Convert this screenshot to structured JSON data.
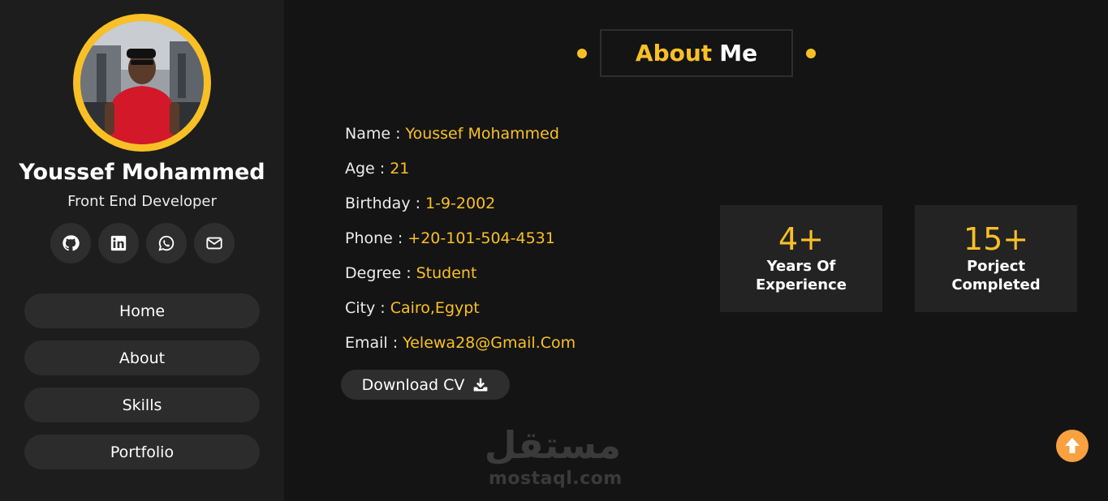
{
  "profile": {
    "name": "Youssef Mohammed",
    "role": "Front End Developer",
    "socials": [
      "github-icon",
      "linkedin-icon",
      "whatsapp-icon",
      "envelope-icon"
    ]
  },
  "nav": {
    "items": [
      {
        "label": "Home"
      },
      {
        "label": "About"
      },
      {
        "label": "Skills"
      },
      {
        "label": "Portfolio"
      }
    ]
  },
  "about": {
    "title_highlight": "About",
    "title_rest": "Me",
    "info": [
      {
        "label": "Name :",
        "value": "Youssef Mohammed"
      },
      {
        "label": "Age :",
        "value": "21"
      },
      {
        "label": "Birthday :",
        "value": "1-9-2002"
      },
      {
        "label": "Phone :",
        "value": "+20-101-504-4531"
      },
      {
        "label": "Degree :",
        "value": "Student"
      },
      {
        "label": "City :",
        "value": "Cairo,Egypt"
      },
      {
        "label": "Email :",
        "value": "Yelewa28@Gmail.Com"
      }
    ],
    "download_label": "Download CV"
  },
  "stats": [
    {
      "number": "4+",
      "line1": "Years Of",
      "line2": "Experience"
    },
    {
      "number": "15+",
      "line1": "Porject",
      "line2": "Completed"
    }
  ],
  "watermark": {
    "arabic": "مستقل",
    "latin": "mostaql.com"
  },
  "colors": {
    "accent": "#f9c025",
    "sidebar_bg": "#1d1d1d",
    "page_bg": "#141414",
    "scroll_top": "#f9a03f"
  }
}
